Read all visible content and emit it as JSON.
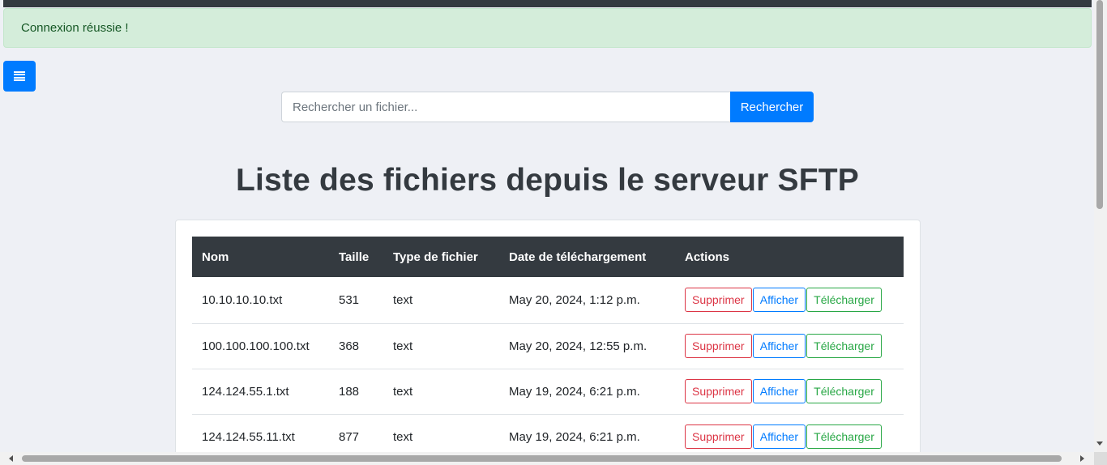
{
  "alert": {
    "text": "Connexion réussie !"
  },
  "menu": {
    "icon": "menu-icon"
  },
  "search": {
    "placeholder": "Rechercher un fichier...",
    "value": "",
    "button_label": "Rechercher"
  },
  "page": {
    "title": "Liste des fichiers depuis le serveur SFTP"
  },
  "table": {
    "headers": [
      "Nom",
      "Taille",
      "Type de fichier",
      "Date de téléchargement",
      "Actions"
    ],
    "rows": [
      {
        "name": "10.10.10.10.txt",
        "size": "531",
        "type": "text",
        "date": "May 20, 2024, 1:12 p.m."
      },
      {
        "name": "100.100.100.100.txt",
        "size": "368",
        "type": "text",
        "date": "May 20, 2024, 12:55 p.m."
      },
      {
        "name": "124.124.55.1.txt",
        "size": "188",
        "type": "text",
        "date": "May 19, 2024, 6:21 p.m."
      },
      {
        "name": "124.124.55.11.txt",
        "size": "877",
        "type": "text",
        "date": "May 19, 2024, 6:21 p.m."
      }
    ],
    "actions": {
      "delete": "Supprimer",
      "view": "Afficher",
      "download": "Télécharger"
    }
  },
  "colors": {
    "primary": "#007bff",
    "danger": "#dc3545",
    "success": "#28a745",
    "dark": "#343a40",
    "alert_bg": "#d4edda"
  }
}
